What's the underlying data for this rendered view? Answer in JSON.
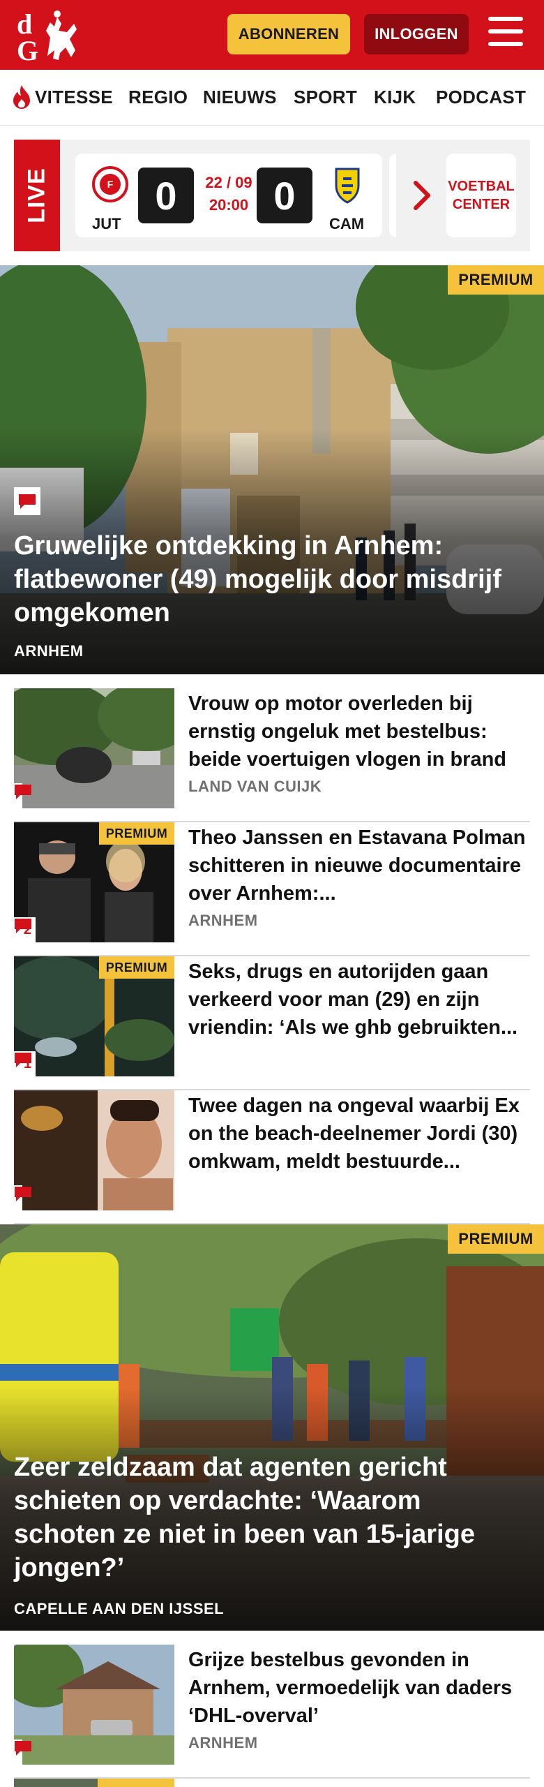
{
  "header": {
    "logo_alt": "dG",
    "subscribe_label": "ABONNEREN",
    "login_label": "INLOGGEN"
  },
  "nav": {
    "items": [
      "VITESSE",
      "REGIO",
      "NIEUWS",
      "SPORT",
      "KIJK",
      "PODCAST"
    ]
  },
  "live": {
    "label": "LIVE",
    "match": {
      "home_code": "JUT",
      "away_code": "CAM",
      "home_score": "0",
      "away_score": "0",
      "date": "22 / 09",
      "time": "20:00"
    },
    "football_center_line1": "VOETBAL",
    "football_center_line2": "CENTER"
  },
  "articles": [
    {
      "title": "Gruwelijke ontdekking in Arnhem: flatbewoner (49) mogelijk door misdrijf omgekomen",
      "category": "ARNHEM",
      "premium": "PREMIUM",
      "comments": ""
    },
    {
      "title": "Vrouw op motor overleden bij ernstig ongeluk met bestelbus: beide voertuigen vlogen in brand",
      "category": "LAND VAN CUIJK",
      "comments": ""
    },
    {
      "title": "Theo Janssen en Estavana Polman schitteren in nieuwe documentaire over Arnhem:...",
      "category": "ARNHEM",
      "premium": "PREMIUM",
      "comments": "2"
    },
    {
      "title": "Seks, drugs en autorijden gaan verkeerd voor man (29) en zijn vriendin: ‘Als we ghb gebruikten...",
      "category": "",
      "premium": "PREMIUM",
      "comments": "1"
    },
    {
      "title": "Twee dagen na ongeval waarbij Ex on the beach-deelnemer Jordi (30) omkwam, meldt bestuurde...",
      "category": "",
      "comments": ""
    },
    {
      "title": "Zeer zeldzaam dat agenten gericht schieten op verdachte: ‘Waarom schoten ze niet in been van 15-jarige jongen?’",
      "category": "CAPELLE AAN DEN IJSSEL",
      "premium": "PREMIUM"
    },
    {
      "title": "Grijze bestelbus gevonden in Arnhem, vermoedelijk van daders ‘DHL-overval’",
      "category": "ARNHEM",
      "comments": ""
    }
  ],
  "colors": {
    "brand_red": "#d3111b",
    "premium_yellow": "#f5c33b",
    "login_dark_red": "#8f0b11"
  }
}
